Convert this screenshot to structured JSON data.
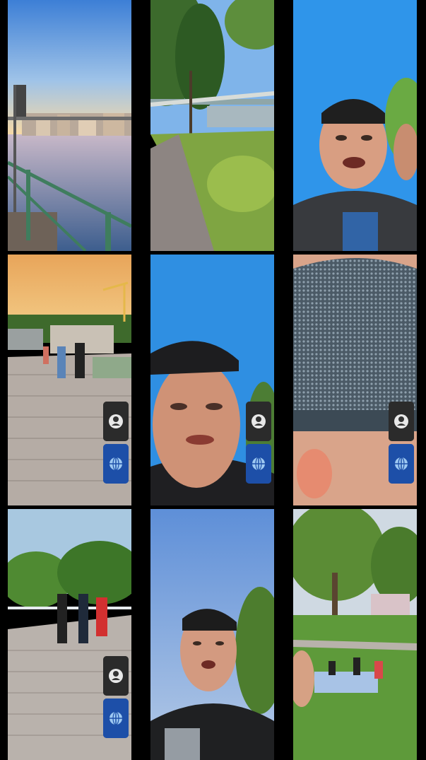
{
  "grid": {
    "rows": 3,
    "cols": 3,
    "tiles": [
      {
        "id": "t1",
        "scene": "river-promenade-sunset",
        "badges": false
      },
      {
        "id": "t2",
        "scene": "park-path-tree-bridge",
        "badges": false
      },
      {
        "id": "t3",
        "scene": "selfie-man-cap-blue-sky",
        "badges": false
      },
      {
        "id": "t4",
        "scene": "boardwalk-people-cranes",
        "badges": true
      },
      {
        "id": "t5",
        "scene": "selfie-man-blurred",
        "badges": true
      },
      {
        "id": "t6",
        "scene": "close-up-mesh-cap",
        "badges": true
      },
      {
        "id": "t7",
        "scene": "bridge-walkers-trees",
        "badges": true
      },
      {
        "id": "t8",
        "scene": "selfie-man-looking-up",
        "badges": false
      },
      {
        "id": "t9",
        "scene": "park-picnic-lawn",
        "badges": false
      }
    ]
  },
  "badges": [
    {
      "icon": "person-portrait-icon",
      "bg": "#2b2b2b"
    },
    {
      "icon": "globe-icon",
      "bg": "#1d4fa8"
    }
  ],
  "colors": {
    "background": "#000000",
    "sky": "#3a8de0",
    "grass": "#6c9e3a",
    "sunset": "#f5c98a"
  }
}
